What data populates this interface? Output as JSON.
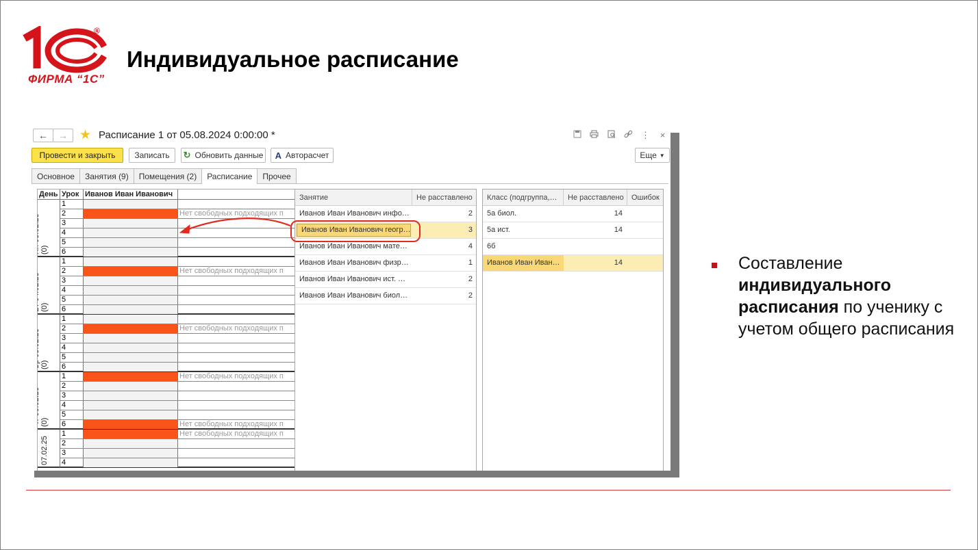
{
  "brand": {
    "logo_text": "ФИРМА “1С”",
    "reg_mark": "®",
    "color": "#d4141a"
  },
  "slide": {
    "title": "Индивидуальное расписание"
  },
  "window": {
    "title": "Расписание 1 от 05.08.2024 0:00:00 *",
    "nav_back": "←",
    "nav_forward": "→",
    "icons": [
      "save-icon",
      "print-icon",
      "preview-icon",
      "link-icon",
      "more-vertical-icon",
      "close-icon"
    ],
    "toolbar": {
      "post_close": "Провести и закрыть",
      "save": "Записать",
      "refresh": "Обновить данные",
      "autocalc": "Авторасчет",
      "more": "Еще"
    },
    "tabs": [
      "Основное",
      "Занятия (9)",
      "Помещения (2)",
      "Расписание",
      "Прочее"
    ],
    "active_tab": "Расписание"
  },
  "schedule": {
    "headers": {
      "day": "День",
      "lesson": "Урок",
      "student": "Иванов Иван Иванович"
    },
    "busy_color": "#f9541a",
    "note": "Нет свободных подходящих п",
    "days": [
      {
        "name": "Пн 03.02.25",
        "count": "(0)",
        "lessons": [
          {
            "n": "1",
            "busy": false,
            "note": ""
          },
          {
            "n": "2",
            "busy": true,
            "note": "Нет свободных подходящих п"
          },
          {
            "n": "3",
            "busy": false,
            "note": ""
          },
          {
            "n": "4",
            "busy": false,
            "note": ""
          },
          {
            "n": "5",
            "busy": false,
            "note": ""
          },
          {
            "n": "6",
            "busy": false,
            "note": ""
          }
        ]
      },
      {
        "name": "Вт 04.02.25",
        "count": "(0)",
        "lessons": [
          {
            "n": "1",
            "busy": false,
            "note": ""
          },
          {
            "n": "2",
            "busy": true,
            "note": "Нет свободных подходящих п"
          },
          {
            "n": "3",
            "busy": false,
            "note": ""
          },
          {
            "n": "4",
            "busy": false,
            "note": ""
          },
          {
            "n": "5",
            "busy": false,
            "note": ""
          },
          {
            "n": "6",
            "busy": false,
            "note": ""
          }
        ]
      },
      {
        "name": "Ср 05.02.25",
        "count": "(0)",
        "lessons": [
          {
            "n": "1",
            "busy": false,
            "note": ""
          },
          {
            "n": "2",
            "busy": true,
            "note": "Нет свободных подходящих п"
          },
          {
            "n": "3",
            "busy": false,
            "note": ""
          },
          {
            "n": "4",
            "busy": false,
            "note": ""
          },
          {
            "n": "5",
            "busy": false,
            "note": ""
          },
          {
            "n": "6",
            "busy": false,
            "note": ""
          }
        ]
      },
      {
        "name": "Чт 06.02.25",
        "count": "(0)",
        "lessons": [
          {
            "n": "1",
            "busy": true,
            "note": "Нет свободных подходящих п"
          },
          {
            "n": "2",
            "busy": false,
            "note": ""
          },
          {
            "n": "3",
            "busy": false,
            "note": ""
          },
          {
            "n": "4",
            "busy": false,
            "note": ""
          },
          {
            "n": "5",
            "busy": false,
            "note": ""
          },
          {
            "n": "6",
            "busy": true,
            "note": "Нет свободных подходящих п"
          }
        ]
      },
      {
        "name": "07.02.25",
        "count": "",
        "lessons": [
          {
            "n": "1",
            "busy": true,
            "note": "Нет свободных подходящих п"
          },
          {
            "n": "2",
            "busy": false,
            "note": ""
          },
          {
            "n": "3",
            "busy": false,
            "note": ""
          },
          {
            "n": "4",
            "busy": false,
            "note": ""
          }
        ]
      }
    ]
  },
  "lessons_table": {
    "headers": [
      "Занятие",
      "Не расставлено"
    ],
    "rows": [
      {
        "name": "Иванов Иван Иванович инфо…",
        "count": "2",
        "selected": false
      },
      {
        "name": "Иванов Иван Иванович геогр…",
        "count": "3",
        "selected": true
      },
      {
        "name": "Иванов Иван Иванович мате…",
        "count": "4",
        "selected": false
      },
      {
        "name": "Иванов Иван Иванович физр…",
        "count": "1",
        "selected": false
      },
      {
        "name": "Иванов Иван Иванович ист. …",
        "count": "2",
        "selected": false
      },
      {
        "name": "Иванов Иван Иванович биол…",
        "count": "2",
        "selected": false
      }
    ]
  },
  "classes_table": {
    "headers": [
      "Класс (подгруппа,…",
      "Не расставлено",
      "Ошибок"
    ],
    "rows": [
      {
        "name": "5а биол.",
        "count": "14",
        "errors": "",
        "selected": false
      },
      {
        "name": "5а ист.",
        "count": "14",
        "errors": "",
        "selected": false
      },
      {
        "name": "6б",
        "count": "",
        "errors": "",
        "selected": false
      },
      {
        "name": "Иванов Иван Иван…",
        "count": "14",
        "errors": "",
        "selected": true
      }
    ]
  },
  "description": {
    "part1": "Составление ",
    "bold": "индивидуального расписания",
    "part2": " по ученику с учетом общего расписания"
  }
}
